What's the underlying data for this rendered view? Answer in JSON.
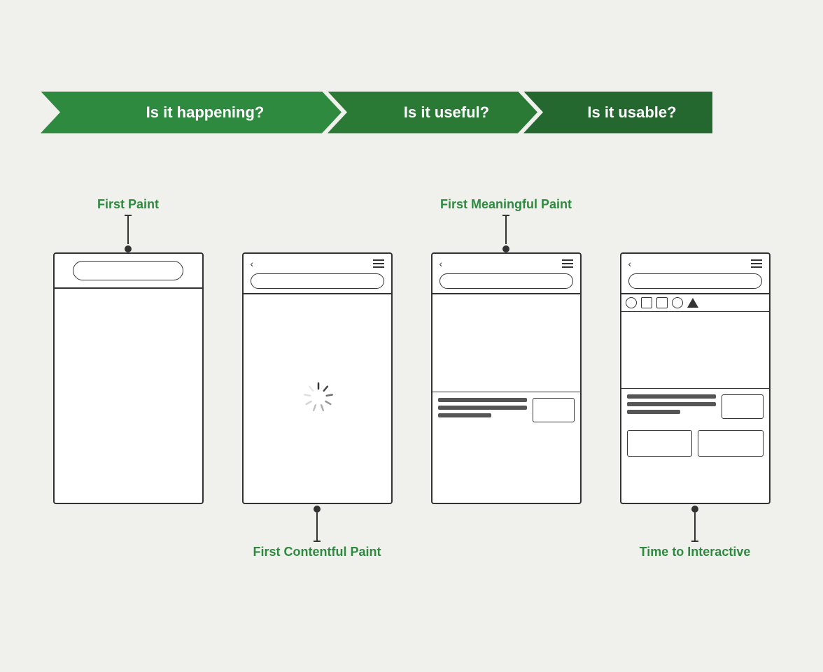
{
  "banner": {
    "segment1": "Is it happening?",
    "segment2": "Is it useful?",
    "segment3": "Is it usable?"
  },
  "stages": [
    {
      "id": "first-paint",
      "label": "First Paint",
      "labelPosition": "top",
      "type": "minimal"
    },
    {
      "id": "first-contentful-paint",
      "label": "First Contentful Paint",
      "labelPosition": "bottom",
      "type": "loading"
    },
    {
      "id": "first-meaningful-paint",
      "label": "First Meaningful Paint",
      "labelPosition": "top",
      "type": "meaningful"
    },
    {
      "id": "time-to-interactive",
      "label": "Time to Interactive",
      "labelPosition": "bottom",
      "type": "interactive"
    }
  ]
}
